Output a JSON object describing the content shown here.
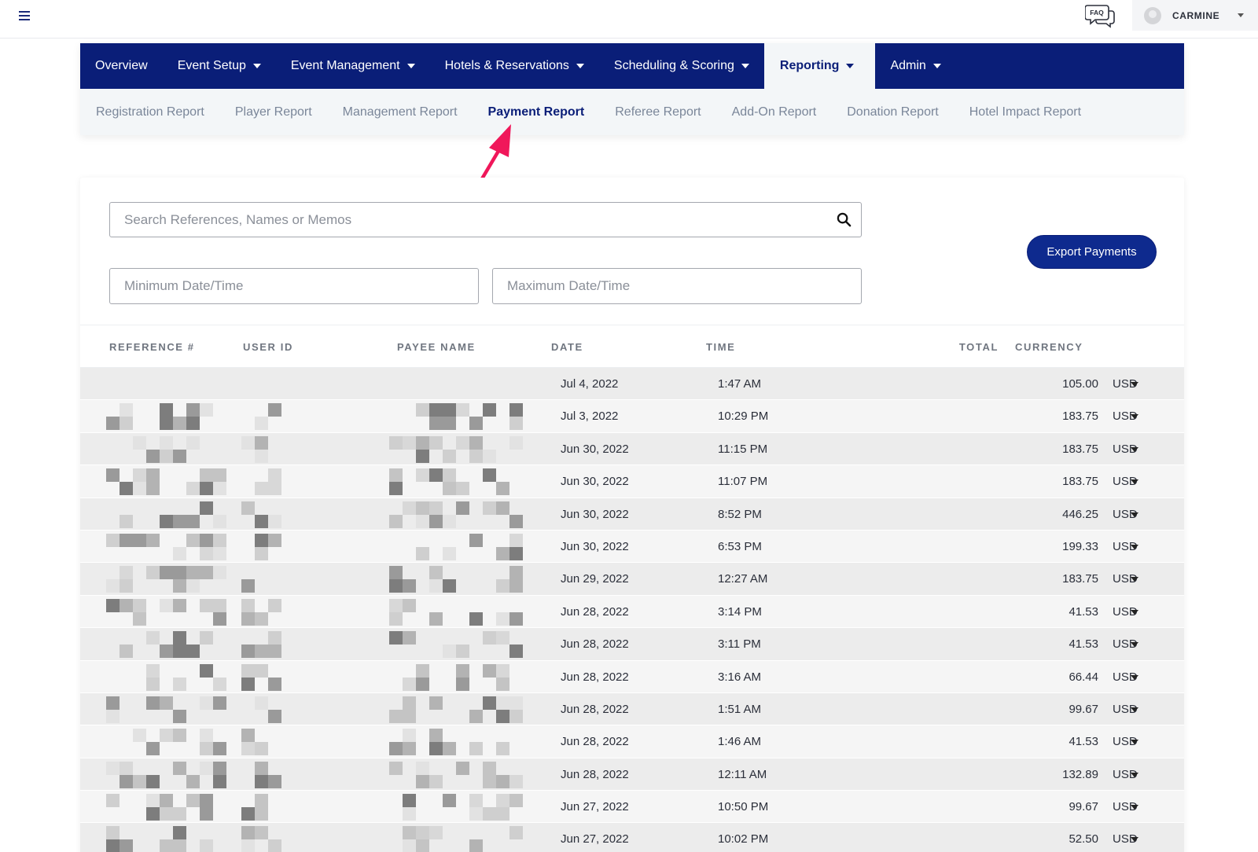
{
  "header": {
    "menu_icon": "hamburger-icon",
    "faq_label": "FAQ",
    "user_name": "CARMINE"
  },
  "nav": {
    "items": [
      {
        "label": "Overview",
        "has_caret": false
      },
      {
        "label": "Event Setup",
        "has_caret": true
      },
      {
        "label": "Event Management",
        "has_caret": true
      },
      {
        "label": "Hotels & Reservations",
        "has_caret": true
      },
      {
        "label": "Scheduling & Scoring",
        "has_caret": true
      },
      {
        "label": "Reporting",
        "has_caret": true,
        "active": true
      },
      {
        "label": "Admin",
        "has_caret": true
      }
    ],
    "sub_items": [
      {
        "label": "Registration Report"
      },
      {
        "label": "Player Report"
      },
      {
        "label": "Management Report"
      },
      {
        "label": "Payment Report",
        "active": true
      },
      {
        "label": "Referee Report"
      },
      {
        "label": "Add-On Report"
      },
      {
        "label": "Donation Report"
      },
      {
        "label": "Hotel Impact Report"
      }
    ]
  },
  "filters": {
    "search_placeholder": "Search References, Names or Memos",
    "search_value": "",
    "min_date_placeholder": "Minimum Date/Time",
    "max_date_placeholder": "Maximum Date/Time",
    "export_label": "Export Payments"
  },
  "table": {
    "columns": [
      "REFERENCE #",
      "USER ID",
      "PAYEE NAME",
      "DATE",
      "TIME",
      "TOTAL",
      "CURRENCY"
    ],
    "rows": [
      {
        "date": "Jul 4, 2022",
        "time": "1:47 AM",
        "total": "105.00",
        "currency": "USD"
      },
      {
        "date": "Jul 3, 2022",
        "time": "10:29 PM",
        "total": "183.75",
        "currency": "USD"
      },
      {
        "date": "Jun 30, 2022",
        "time": "11:15 PM",
        "total": "183.75",
        "currency": "USD"
      },
      {
        "date": "Jun 30, 2022",
        "time": "11:07 PM",
        "total": "183.75",
        "currency": "USD"
      },
      {
        "date": "Jun 30, 2022",
        "time": "8:52 PM",
        "total": "446.25",
        "currency": "USD"
      },
      {
        "date": "Jun 30, 2022",
        "time": "6:53 PM",
        "total": "199.33",
        "currency": "USD"
      },
      {
        "date": "Jun 29, 2022",
        "time": "12:27 AM",
        "total": "183.75",
        "currency": "USD"
      },
      {
        "date": "Jun 28, 2022",
        "time": "3:14 PM",
        "total": "41.53",
        "currency": "USD"
      },
      {
        "date": "Jun 28, 2022",
        "time": "3:11 PM",
        "total": "41.53",
        "currency": "USD"
      },
      {
        "date": "Jun 28, 2022",
        "time": "3:16 AM",
        "total": "66.44",
        "currency": "USD"
      },
      {
        "date": "Jun 28, 2022",
        "time": "1:51 AM",
        "total": "99.67",
        "currency": "USD"
      },
      {
        "date": "Jun 28, 2022",
        "time": "1:46 AM",
        "total": "41.53",
        "currency": "USD"
      },
      {
        "date": "Jun 28, 2022",
        "time": "12:11 AM",
        "total": "132.89",
        "currency": "USD"
      },
      {
        "date": "Jun 27, 2022",
        "time": "10:50 PM",
        "total": "99.67",
        "currency": "USD"
      },
      {
        "date": "Jun 27, 2022",
        "time": "10:02 PM",
        "total": "52.50",
        "currency": "USD"
      }
    ]
  },
  "colors": {
    "nav_bg": "#0a1e78",
    "active_text": "#0a1e78",
    "export_button": "#0e2a8e",
    "annotation_arrow": "#f0175a"
  }
}
